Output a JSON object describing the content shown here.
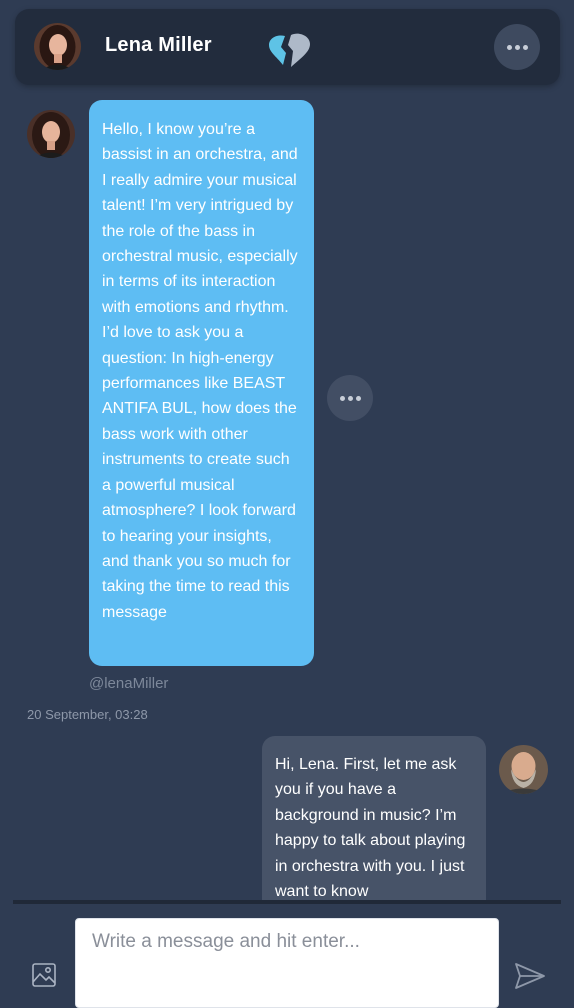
{
  "header": {
    "contact_name": "Lena Miller",
    "more_icon": "more-horizontal-icon",
    "logo": "broken-heart-logo"
  },
  "conversation": {
    "messages": [
      {
        "direction": "incoming",
        "text": "Hello, I know you’re a bassist in an orchestra, and I really admire your musical talent! I’m very intrigued by the role of the bass in orchestral music, especially in terms of its interaction with emotions and rhythm. I’d love to ask you a question: In high-energy performances like BEAST ANTIFA BUL, how does the bass work with other instruments to create such a powerful musical atmosphere? I look forward to hearing your insights, and thank you so much for taking the time to read this message",
        "sender_handle": "@lenaMiller"
      },
      {
        "direction": "outgoing",
        "text": "Hi, Lena. First, let me ask you if you have a background in music? I’m happy to talk about playing in orchestra with you. I just want to know"
      }
    ],
    "timestamp": "20 September, 03:28"
  },
  "composer": {
    "placeholder": "Write a message and hit enter...",
    "value": "",
    "attach_icon": "image-icon",
    "send_icon": "send-icon"
  },
  "colors": {
    "background": "#2f3c53",
    "header": "#222c3d",
    "incoming_bubble": "#5ebdf3",
    "outgoing_bubble": "#475368"
  }
}
